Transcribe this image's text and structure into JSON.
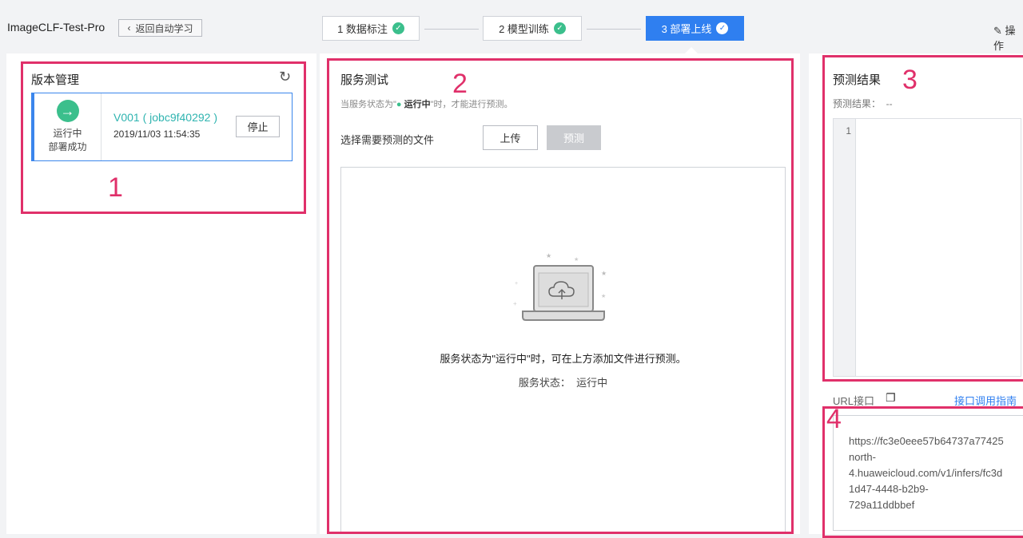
{
  "header": {
    "project": "ImageCLF-Test-Pro",
    "back_label": "返回自动学习",
    "steps": [
      {
        "label": "1 数据标注"
      },
      {
        "label": "2 模型训练"
      },
      {
        "label": "3 部署上线"
      }
    ],
    "ops_label": "操作"
  },
  "version": {
    "title": "版本管理",
    "status1": "运行中",
    "status2": "部署成功",
    "name": "V001 ( jobc9f40292 )",
    "time": "2019/11/03 11:54:35",
    "stop_label": "停止"
  },
  "test": {
    "title": "服务测试",
    "hint_pre": "当服务状态为\"",
    "hint_status": "运行中",
    "hint_post": "\"时，才能进行预测。",
    "select_label": "选择需要预测的文件",
    "upload_label": "上传",
    "predict_label": "预测",
    "empty_msg": "服务状态为\"运行中\"时，可在上方添加文件进行预测。",
    "status_line": "服务状态：  运行中"
  },
  "result": {
    "title": "预测结果",
    "label": "预测结果：  --",
    "line_no": "1"
  },
  "api": {
    "label": "URL接口",
    "guide_link": "接口调用指南",
    "url": "https://fc3e0eee57b64737a77425\nnorth-\n4.huaweicloud.com/v1/infers/fc3d\n1d47-4448-b2b9-\n729a11ddbbef"
  },
  "annotations": [
    "1",
    "2",
    "3",
    "4"
  ],
  "colors": {
    "accent": "#2f7ff0",
    "success": "#3bbf8c",
    "annotation": "#e0306a"
  }
}
